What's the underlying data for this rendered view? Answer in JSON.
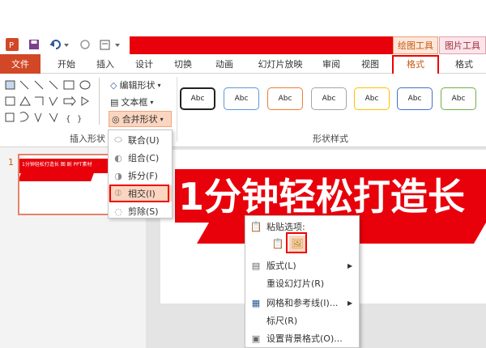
{
  "quick_access": {
    "icons": [
      "powerpoint-icon",
      "save-icon",
      "undo-icon",
      "redo-icon",
      "customize-icon"
    ]
  },
  "context_tabs": {
    "drawing_tools": "绘图工具",
    "picture_tools": "图片工具"
  },
  "tabs": [
    "文件",
    "开始",
    "插入",
    "设计",
    "切换",
    "动画",
    "幻灯片放映",
    "审阅",
    "视图",
    "格式",
    "格式"
  ],
  "ribbon": {
    "edit_shape": "编辑形状",
    "text_box": "文本框",
    "merge_shapes": "合并形状",
    "insert_shapes_label": "插入形状",
    "shape_styles_label": "形状样式",
    "style_sample": "Abc"
  },
  "dropdown": {
    "items": [
      "联合(U)",
      "组合(C)",
      "拆分(F)",
      "相交(I)",
      "剪除(S)"
    ]
  },
  "thumbnail": {
    "number": "1",
    "title": "1分钟轻松打造长 图 剧 PPT素材"
  },
  "slide": {
    "headline": "1分钟轻松打造长"
  },
  "context_menu": {
    "paste_options": "粘贴选项:",
    "items": [
      "版式(L)",
      "重设幻灯片(R)",
      "网格和参考线(I)...",
      "标尺(R)",
      "设置背景格式(O)..."
    ]
  },
  "colors": {
    "accent_red": "#e8000b",
    "file_tab": "#d24726",
    "highlight_box": "#e00000"
  }
}
